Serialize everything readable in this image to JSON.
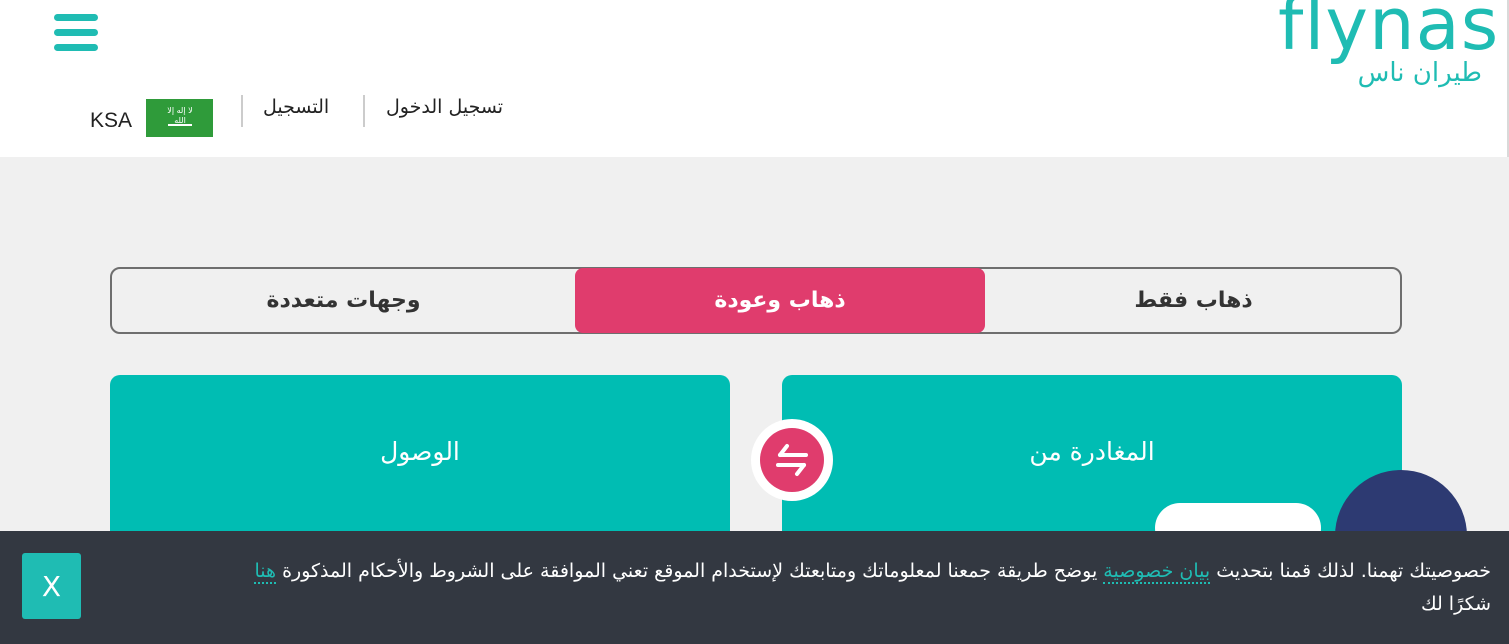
{
  "header": {
    "logo_text": "flynas",
    "logo_subtext": "طيران ناس",
    "country": "KSA",
    "nav_register": "التسجيل",
    "nav_login": "تسجيل الدخول"
  },
  "trip_tabs": {
    "one_way": "ذهاب فقط",
    "return": "ذهاب وعودة",
    "multi_city": "وجهات متعددة",
    "selected": "ذهاب وعودة"
  },
  "search": {
    "from_label": "المغادرة من",
    "to_label": "الوصول"
  },
  "cookie_banner": {
    "text_before_link": "خصوصيتك تهمنا. لذلك قمنا بتحديث",
    "privacy_link": "بيان خصوصية",
    "text_after_link": "يوضح طريقة جمعنا لمعلوماتك ومتابعتك لإستخدام الموقع تعني الموافقة على الشروط والأحكام المذكورة",
    "here_link": "هنا",
    "thanks": "شكرًا لك",
    "close_label": "X"
  },
  "colors": {
    "brand_teal": "#00bdb3",
    "accent_pink": "#e03c6d",
    "banner_bg": "#333841",
    "chat_navy": "#2d3a72"
  },
  "icons": {
    "menu": "hamburger-menu-icon",
    "swap": "swap-arrows-icon",
    "flag": "saudi-flag-icon",
    "chat": "chat-bubble-icon"
  }
}
